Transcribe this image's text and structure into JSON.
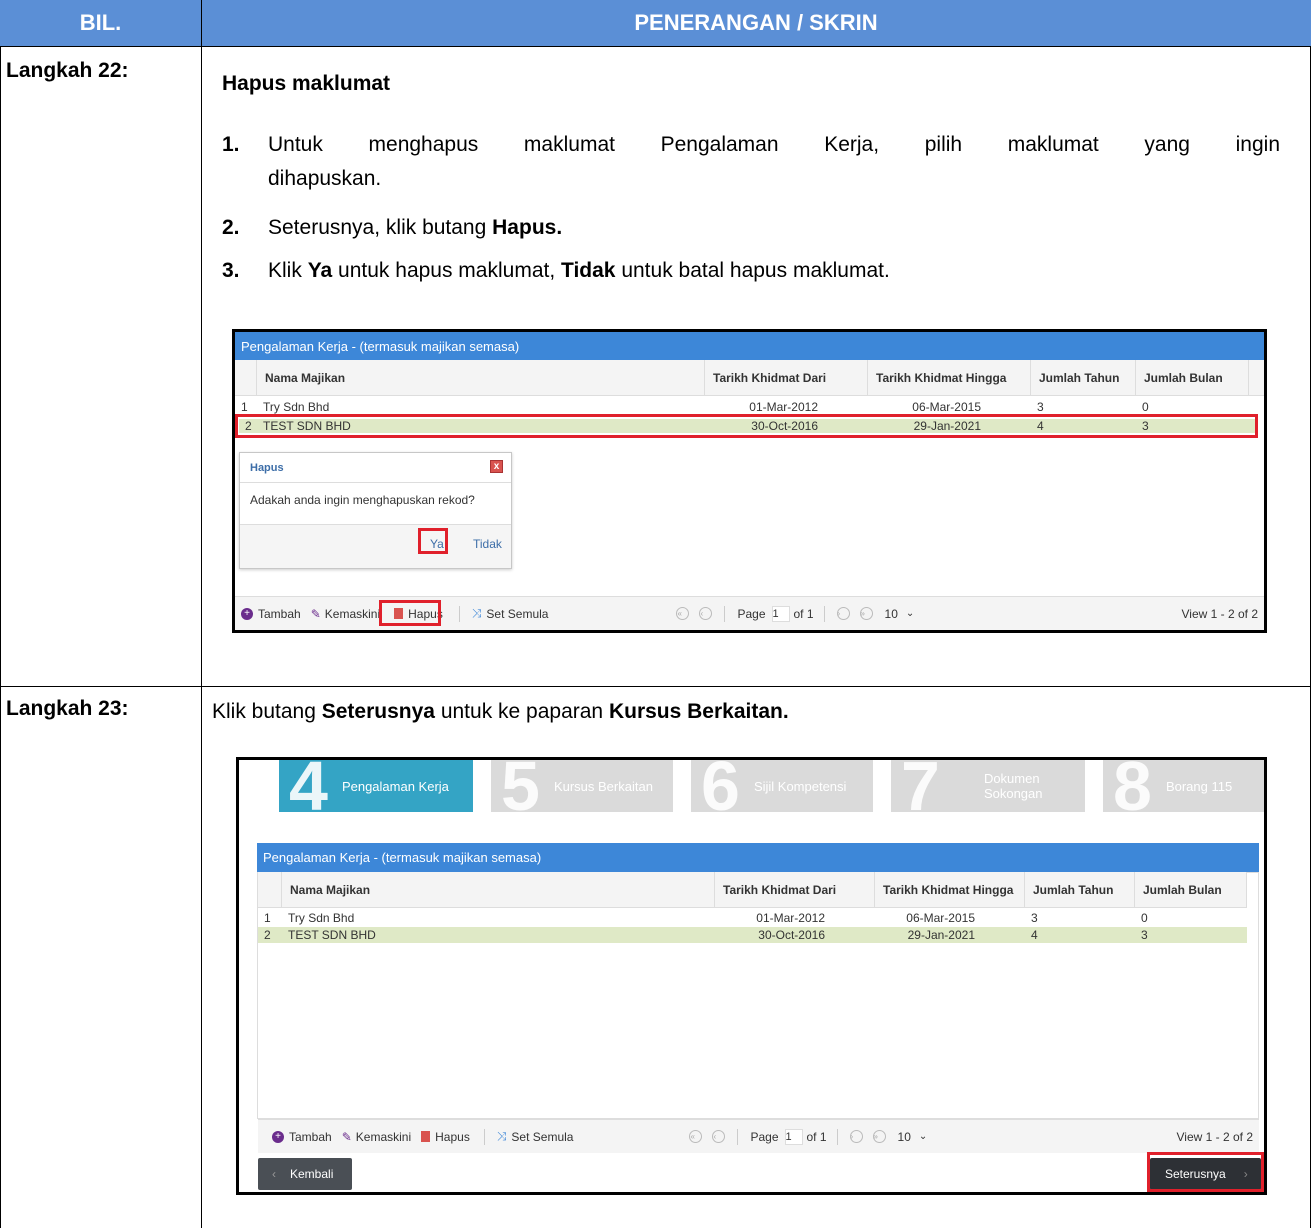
{
  "header": {
    "col1": "BIL.",
    "col2": "PENERANGAN / SKRIN"
  },
  "step22": {
    "label": "Langkah 22:",
    "title": "Hapus maklumat",
    "items": [
      {
        "num": "1.",
        "line1": "Untuk menghapus maklumat Pengalaman Kerja, pilih maklumat yang ingin",
        "line2": "dihapuskan."
      },
      {
        "num": "2.",
        "pre": "Seterusnya, klik butang ",
        "bold": "Hapus."
      },
      {
        "num": "3.",
        "pre": "Klik ",
        "b1": "Ya",
        "mid": " untuk hapus maklumat, ",
        "b2": "Tidak",
        "post": " untuk batal hapus maklumat."
      }
    ]
  },
  "step23": {
    "label": "Langkah 23:",
    "pre": "Klik butang ",
    "b1": "Seterusnya",
    "mid": " untuk ke paparan ",
    "b2": "Kursus Berkaitan."
  },
  "grid": {
    "title": "Pengalaman Kerja - (termasuk majikan semasa)",
    "columns": [
      "Nama Majikan",
      "Tarikh Khidmat Dari",
      "Tarikh Khidmat Hingga",
      "Jumlah Tahun",
      "Jumlah Bulan"
    ],
    "rows": [
      {
        "no": "1",
        "nama": "Try Sdn Bhd",
        "dari": "01-Mar-2012",
        "hingga": "06-Mar-2015",
        "tahun": "3",
        "bulan": "0"
      },
      {
        "no": "2",
        "nama": "TEST SDN BHD",
        "dari": "30-Oct-2016",
        "hingga": "29-Jan-2021",
        "tahun": "4",
        "bulan": "3"
      }
    ],
    "toolbar": {
      "tambah": "Tambah",
      "kemaskini": "Kemaskini",
      "hapus": "Hapus",
      "set_semula": "Set Semula"
    },
    "pager": {
      "page": "Page",
      "page_no": "1",
      "of": "of 1",
      "per_page": "10",
      "view": "View 1 - 2 of 2"
    }
  },
  "dialog": {
    "title": "Hapus",
    "message": "Adakah anda ingin menghapuskan rekod?",
    "yes": "Ya",
    "no": "Tidak",
    "close": "x"
  },
  "steps": [
    {
      "num": "4",
      "label": "Pengalaman Kerja"
    },
    {
      "num": "5",
      "label": "Kursus Berkaitan"
    },
    {
      "num": "6",
      "label": "Sijil Kompetensi"
    },
    {
      "num": "7",
      "label": "Dokumen Sokongan"
    },
    {
      "num": "8",
      "label": "Borang 115"
    }
  ],
  "nav": {
    "back": "Kembali",
    "next": "Seterusnya"
  },
  "colors": {
    "header": "#5b8fd6",
    "grid_title": "#3d87d8",
    "highlight": "#e0202b",
    "selected_row": "#dfe9c6",
    "step_active": "#34a4c5"
  }
}
